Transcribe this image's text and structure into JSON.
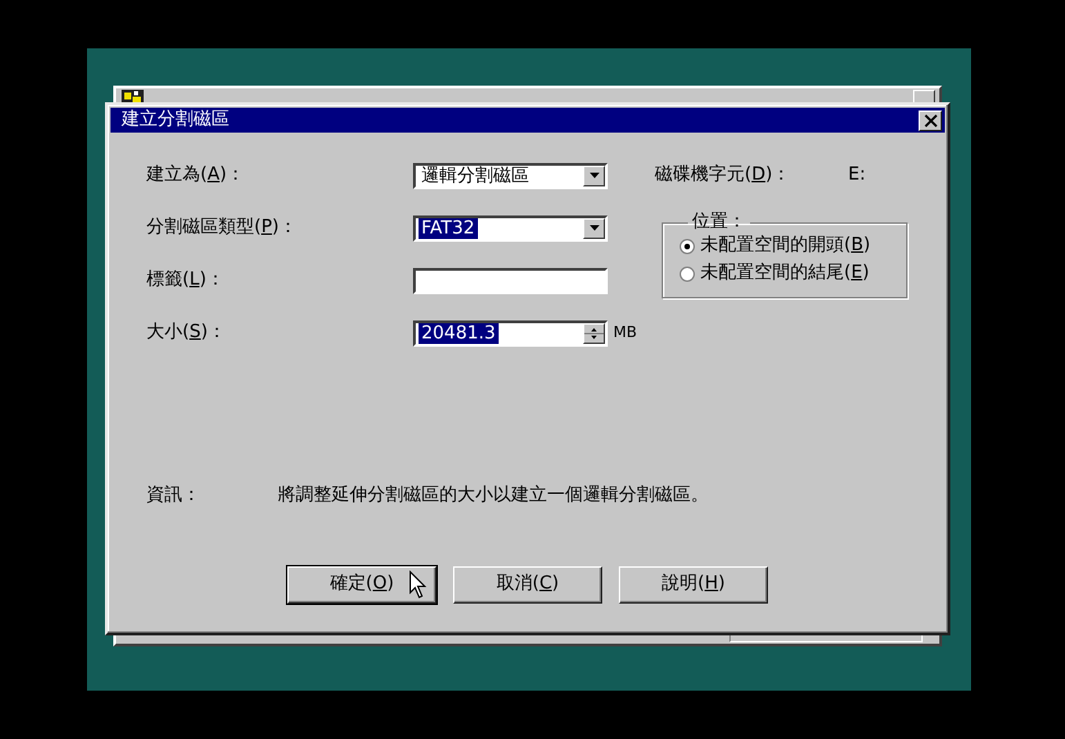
{
  "dialog": {
    "title": "建立分割磁區",
    "fields": [
      {
        "kind": "dropdown",
        "label": "建立為(A)：",
        "value": "邏輯分割磁區",
        "highlighted": false
      },
      {
        "kind": "dropdown",
        "label": "分割磁區類型(P)：",
        "value": "FAT32",
        "highlighted": true
      },
      {
        "kind": "text",
        "label": "標籤(L)："
      },
      {
        "kind": "spinner",
        "label": "大小(S)：",
        "value": "20481.3",
        "highlighted": true,
        "unit": "MB"
      }
    ],
    "drive_letter": {
      "label": "磁碟機字元(D)：",
      "value": "E:"
    },
    "position": {
      "legend": "位置：",
      "options": [
        {
          "label": "未配置空間的開頭(B)",
          "selected": true
        },
        {
          "label": "未配置空間的結尾(E)",
          "selected": false
        }
      ]
    },
    "info": {
      "label": "資訊：",
      "text": "將調整延伸分割磁區的大小以建立一個邏輯分割磁區。"
    },
    "buttons": [
      {
        "label": "確定(O)"
      },
      {
        "label": "取消(C)"
      },
      {
        "label": "說明(H)"
      }
    ]
  }
}
